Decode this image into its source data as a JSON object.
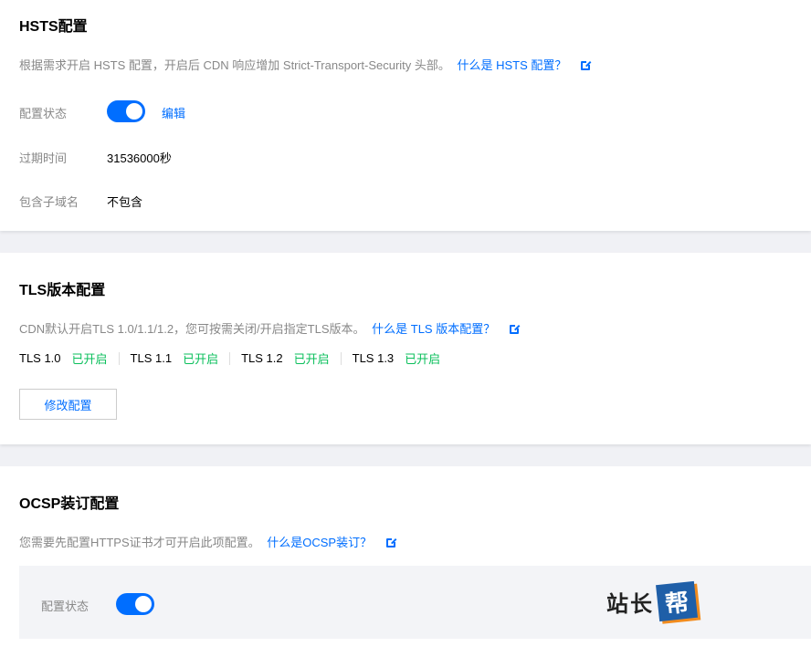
{
  "hsts": {
    "title": "HSTS配置",
    "desc": "根据需求开启 HSTS 配置，开启后 CDN 响应增加 Strict-Transport-Security 头部。",
    "link": "什么是 HSTS 配置？",
    "rows": [
      {
        "label": "配置状态",
        "value": ""
      },
      {
        "label": "过期时间",
        "value": "31536000秒"
      },
      {
        "label": "包含子域名",
        "value": "不包含"
      }
    ],
    "edit_label": "编辑",
    "toggle_on": true
  },
  "tls": {
    "title": "TLS版本配置",
    "desc": "CDN默认开启TLS 1.0/1.1/1.2，您可按需关闭/开启指定TLS版本。",
    "link": "什么是 TLS 版本配置？",
    "versions": [
      {
        "name": "TLS 1.0",
        "status": "已开启"
      },
      {
        "name": "TLS 1.1",
        "status": "已开启"
      },
      {
        "name": "TLS 1.2",
        "status": "已开启"
      },
      {
        "name": "TLS 1.3",
        "status": "已开启"
      }
    ],
    "button_label": "修改配置"
  },
  "ocsp": {
    "title": "OCSP装订配置",
    "desc": "您需要先配置HTTPS证书才可开启此项配置。",
    "link": "什么是OCSP装订？",
    "status_label": "配置状态",
    "toggle_on": true
  },
  "watermark": {
    "text": "站长",
    "box_text": "帮"
  },
  "colors": {
    "accent": "#006eff",
    "success": "#0abf5b"
  }
}
